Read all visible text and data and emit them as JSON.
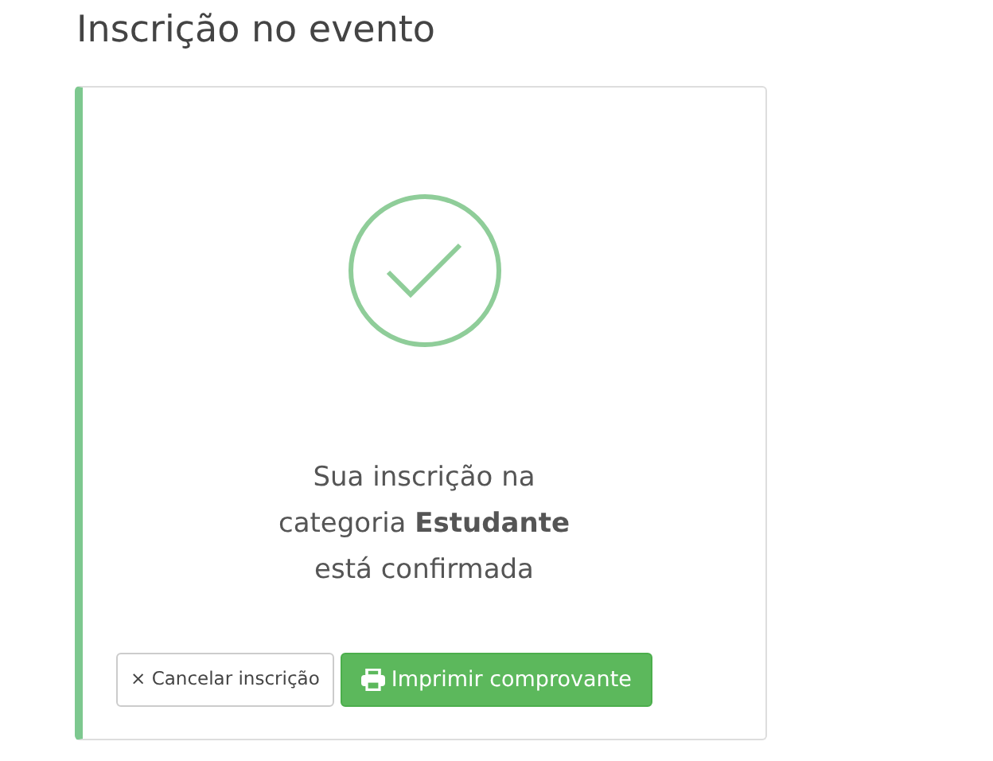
{
  "page_title": "Inscrição no evento",
  "confirmation": {
    "message": "Sua inscrição na categoria **Estudante** está confirmada"
  },
  "buttons": [
    {
      "kind": "cancel",
      "icon_text": "×",
      "label": "Cancelar inscrição"
    },
    {
      "kind": "print",
      "label": "Imprimir comprovante"
    }
  ]
}
